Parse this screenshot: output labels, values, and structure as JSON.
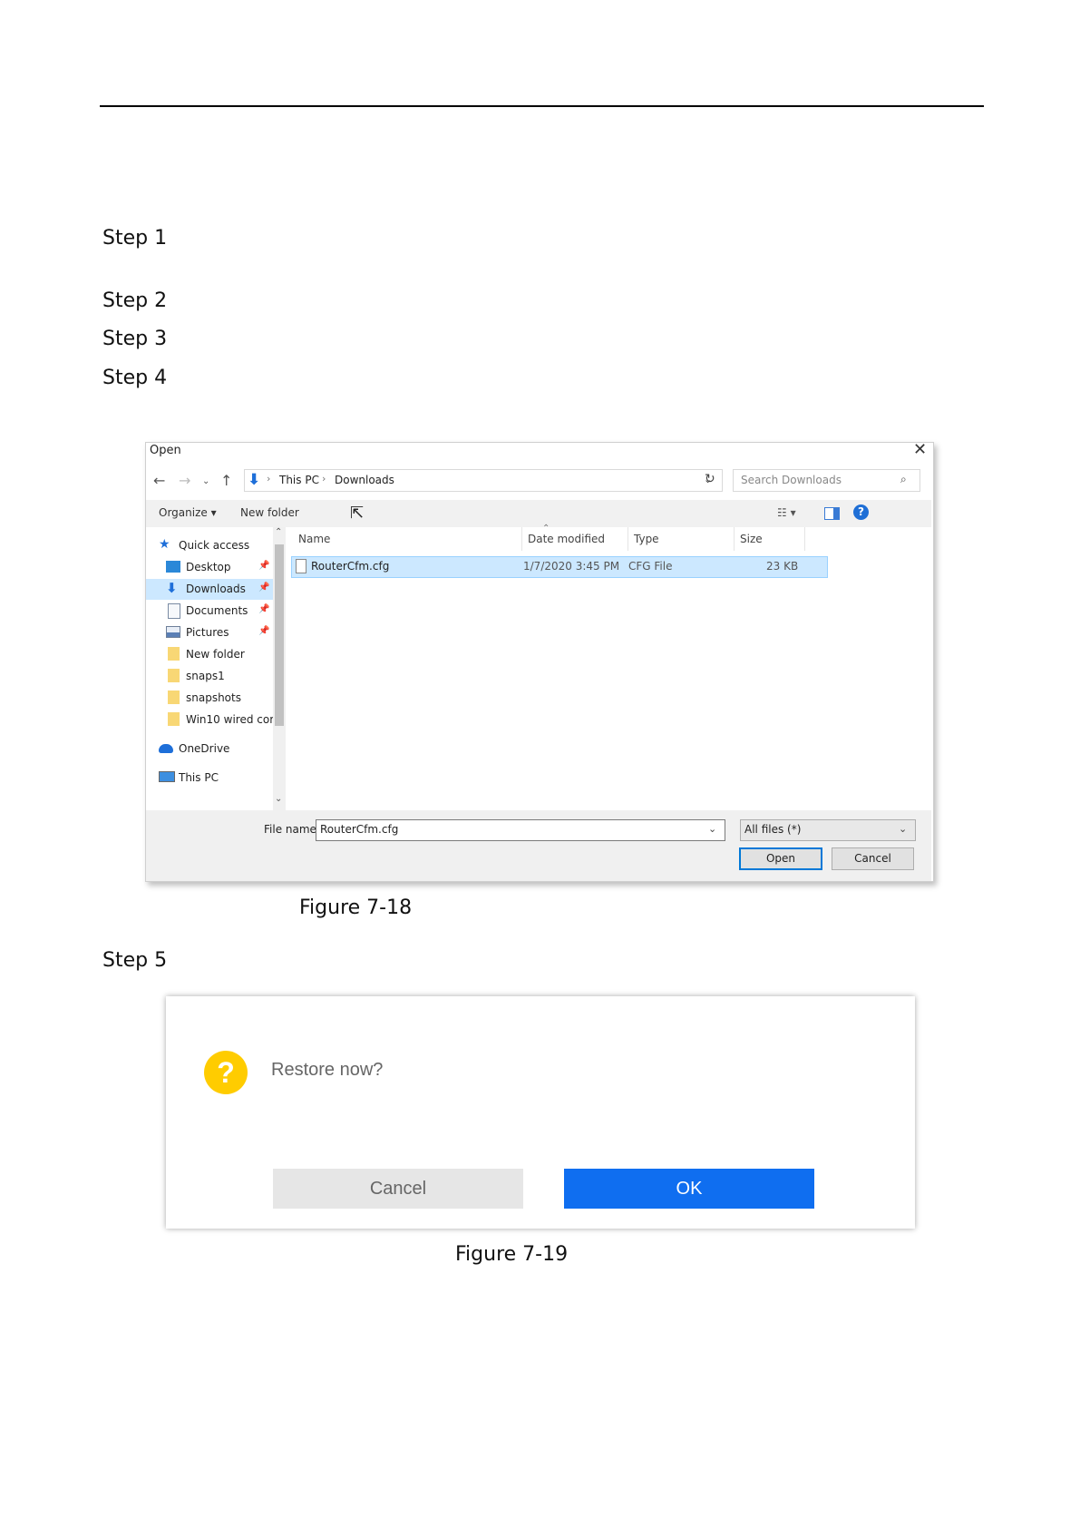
{
  "steps": [
    "Step 1",
    "Step 2",
    "Step 3",
    "Step 4",
    "Step 5"
  ],
  "open_dialog": {
    "title": "Open",
    "address": {
      "crumbs": [
        "This PC",
        "Downloads"
      ]
    },
    "search_placeholder": "Search Downloads",
    "toolbar": {
      "organize": "Organize",
      "new_folder": "New folder"
    },
    "sidebar": [
      {
        "label": "Quick access",
        "icon": "star-icon",
        "pinned": false
      },
      {
        "label": "Desktop",
        "icon": "desktop-icon",
        "pinned": true
      },
      {
        "label": "Downloads",
        "icon": "download-icon",
        "pinned": true,
        "selected": true
      },
      {
        "label": "Documents",
        "icon": "document-icon",
        "pinned": true
      },
      {
        "label": "Pictures",
        "icon": "pictures-icon",
        "pinned": true
      },
      {
        "label": "New folder",
        "icon": "folder-icon",
        "pinned": false
      },
      {
        "label": "snaps1",
        "icon": "folder-icon",
        "pinned": false
      },
      {
        "label": "snapshots",
        "icon": "folder-icon",
        "pinned": false
      },
      {
        "label": "Win10 wired cor",
        "icon": "folder-icon",
        "pinned": false
      },
      {
        "label": "OneDrive",
        "icon": "cloud-icon",
        "pinned": false
      },
      {
        "label": "This PC",
        "icon": "computer-icon",
        "pinned": false
      }
    ],
    "columns": {
      "name": "Name",
      "date": "Date modified",
      "type": "Type",
      "size": "Size"
    },
    "file": {
      "name": "RouterCfm.cfg",
      "date": "1/7/2020 3:45 PM",
      "type": "CFG File",
      "size": "23 KB"
    },
    "file_name_label": "File name:",
    "file_name_value": "RouterCfm.cfg",
    "file_type": "All files (*)",
    "open_label": "Open",
    "cancel_label": "Cancel"
  },
  "caption_1": "Figure 7-18",
  "restore_dialog": {
    "icon": "?",
    "message": "Restore now?",
    "cancel_label": "Cancel",
    "ok_label": "OK"
  },
  "caption_2": "Figure 7-19"
}
